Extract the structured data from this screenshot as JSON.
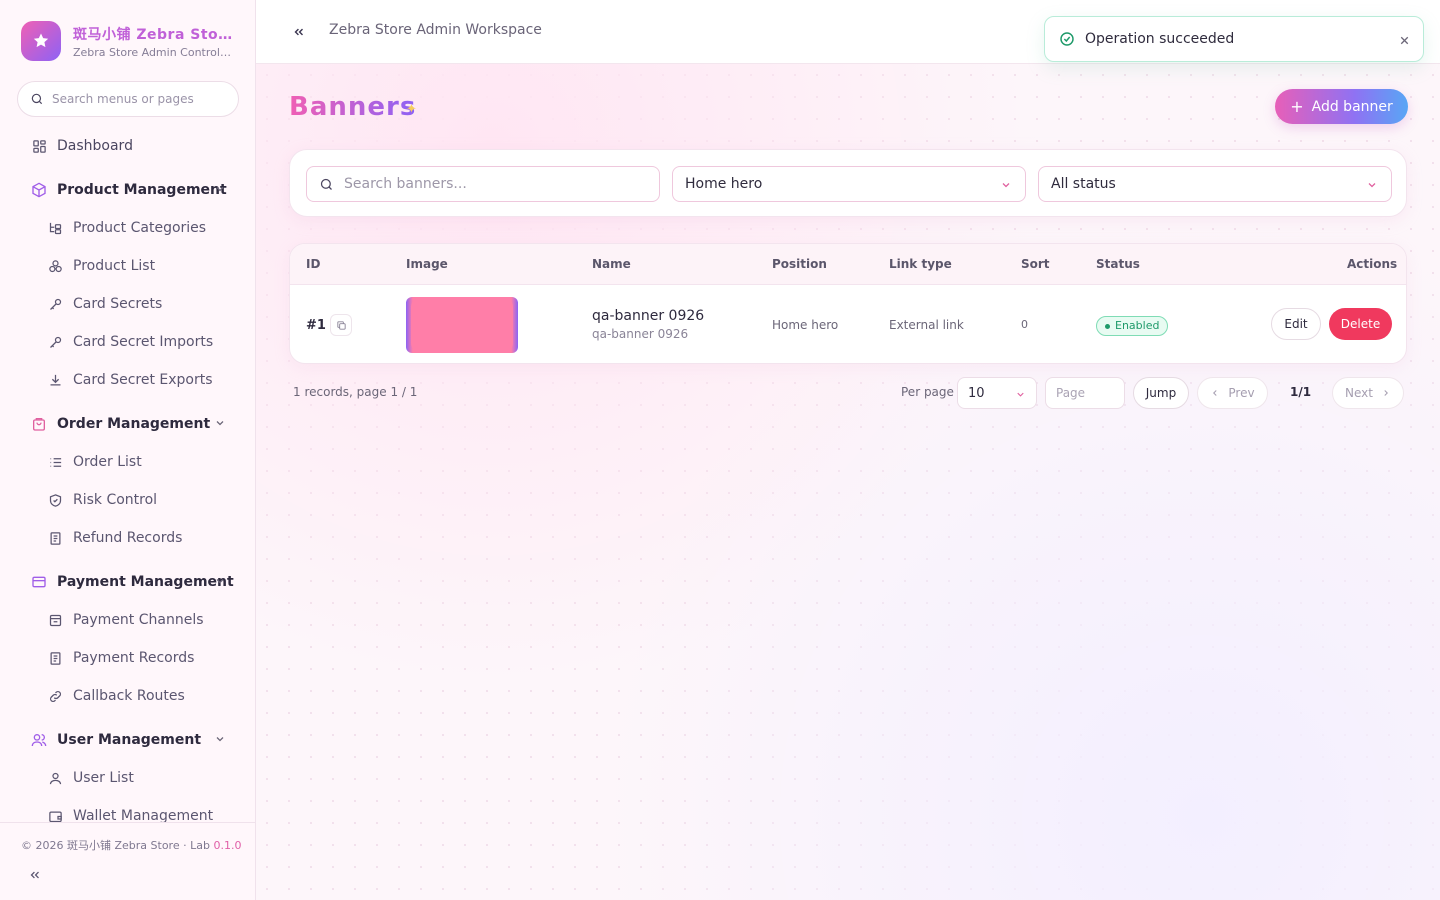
{
  "brand": {
    "name": "斑马小铺 Zebra Store",
    "subtitle": "Zebra Store Admin Control Panel"
  },
  "sidebar": {
    "search_placeholder": "Search menus or pages",
    "items": [
      {
        "label": "Dashboard",
        "icon": "dashboard-icon",
        "type": "item"
      },
      {
        "label": "Product Management",
        "icon": "box-icon",
        "type": "group"
      },
      {
        "label": "Product Categories",
        "icon": "tree-icon",
        "type": "sub"
      },
      {
        "label": "Product List",
        "icon": "cubes-icon",
        "type": "sub"
      },
      {
        "label": "Card Secrets",
        "icon": "key-icon",
        "type": "sub"
      },
      {
        "label": "Card Secret Imports",
        "icon": "key-icon",
        "type": "sub"
      },
      {
        "label": "Card Secret Exports",
        "icon": "download-icon",
        "type": "sub"
      },
      {
        "label": "Order Management",
        "icon": "bag-icon",
        "type": "group"
      },
      {
        "label": "Order List",
        "icon": "list-icon",
        "type": "sub"
      },
      {
        "label": "Risk Control",
        "icon": "shield-icon",
        "type": "sub"
      },
      {
        "label": "Refund Records",
        "icon": "doc-icon",
        "type": "sub"
      },
      {
        "label": "Payment Management",
        "icon": "card-icon",
        "type": "group"
      },
      {
        "label": "Payment Channels",
        "icon": "channel-icon",
        "type": "sub"
      },
      {
        "label": "Payment Records",
        "icon": "doc-icon",
        "type": "sub"
      },
      {
        "label": "Callback Routes",
        "icon": "link-icon",
        "type": "sub"
      },
      {
        "label": "User Management",
        "icon": "users-icon",
        "type": "group"
      },
      {
        "label": "User List",
        "icon": "user-icon",
        "type": "sub"
      },
      {
        "label": "Wallet Management",
        "icon": "wallet-icon",
        "type": "sub"
      }
    ],
    "footer": {
      "copyright": "© 2026 斑马小铺 Zebra Store · Lab",
      "version": "0.1.0"
    }
  },
  "topbar": {
    "title": "Zebra Store Admin Workspace"
  },
  "toast": {
    "message": "Operation succeeded"
  },
  "page": {
    "title": "Banners",
    "add_button": "Add banner"
  },
  "filters": {
    "search_placeholder": "Search banners...",
    "position_value": "Home hero",
    "status_value": "All status"
  },
  "table": {
    "columns": [
      "ID",
      "Image",
      "Name",
      "Position",
      "Link type",
      "Sort",
      "Status",
      "Actions"
    ],
    "rows": [
      {
        "id": "#1",
        "name": "qa-banner 0926",
        "name_sub": "qa-banner 0926",
        "position": "Home hero",
        "link_type": "External link",
        "sort": "0",
        "status": "Enabled",
        "edit_label": "Edit",
        "delete_label": "Delete"
      }
    ]
  },
  "pagination": {
    "info": "1 records, page 1 / 1",
    "per_page_label": "Per page",
    "per_page_value": "10",
    "page_placeholder": "Page",
    "jump_label": "Jump",
    "prev_label": "Prev",
    "current": "1/1",
    "next_label": "Next"
  },
  "colors": {
    "accent_pink": "#f05fb4",
    "accent_purple": "#8d62f5",
    "delete_red": "#f0395e",
    "success_green": "#1f9a6a"
  }
}
